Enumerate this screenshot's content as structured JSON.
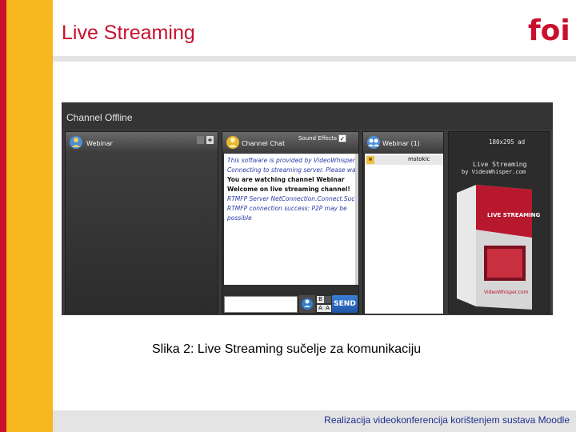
{
  "slide": {
    "title": "Live Streaming",
    "logo_text": "foi",
    "caption": "Slika 2: Live Streaming sučelje za komunikaciju",
    "footer": "Realizacija videokonferencija korištenjem sustava Moodle"
  },
  "colors": {
    "accent_red": "#c8102e",
    "accent_yellow": "#f7b71e",
    "footer_text": "#1f2f8f",
    "send_button": "#2a66bf"
  },
  "app": {
    "status": "Channel Offline",
    "webinar_panel": {
      "title": "Webinar",
      "icon": "user-globe-icon"
    },
    "chat_panel": {
      "title": "Channel Chat",
      "sound_effects_label": "Sound Effects",
      "sound_effects_checked": true,
      "messages": [
        {
          "text": "This software is provided by VideoWhisper.com",
          "style": "info"
        },
        {
          "text": "Connecting to streaming server. Please wait...",
          "style": "info"
        },
        {
          "text": "You are watching channel Webinar",
          "style": "bold"
        },
        {
          "text": "Welcome on live streaming channel!",
          "style": "bold"
        },
        {
          "text": "RTMFP Server NetConnection.Connect.Success",
          "style": "info"
        },
        {
          "text": "RTMFP connection success: P2P may be",
          "style": "info"
        },
        {
          "text": "possible",
          "style": "info"
        }
      ],
      "send_label": "SEND",
      "input_value": ""
    },
    "users_panel": {
      "title": "Webinar (1)",
      "users": [
        {
          "name": "mstokic"
        }
      ]
    },
    "promo": {
      "size_label": "180x295 ad",
      "title": "Live Streaming",
      "by_line": "by VideoWhisper.com",
      "box_brand": "LIVE STREAMING",
      "box_site": "VideoWhisper.com"
    }
  }
}
